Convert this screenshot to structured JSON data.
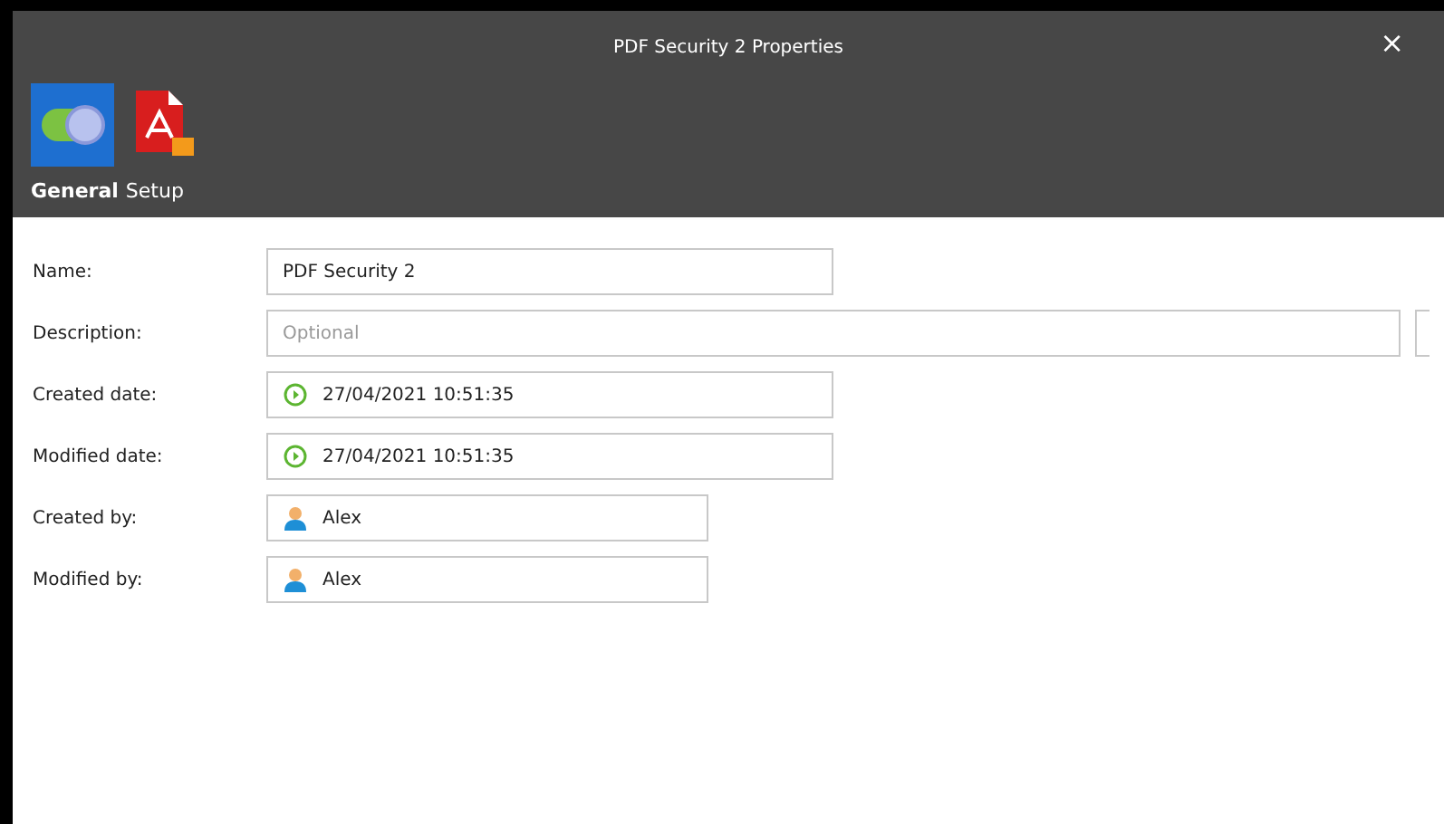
{
  "window": {
    "title": "PDF Security 2 Properties",
    "close": "×"
  },
  "tabs": [
    {
      "label": "General",
      "selected": true,
      "kind": "general"
    },
    {
      "label": "Setup",
      "selected": false,
      "kind": "pdf"
    }
  ],
  "fields": [
    {
      "label": "Name:",
      "kind": "text",
      "value": "PDF Security 2"
    },
    {
      "label": "Description:",
      "kind": "wide",
      "placeholder": "Optional"
    },
    {
      "label": "Created date:",
      "kind": "date",
      "value": "27/04/2021 10:51:35"
    },
    {
      "label": "Modified date:",
      "kind": "date",
      "value": "27/04/2021 10:51:35"
    },
    {
      "label": "Created by:",
      "kind": "user",
      "value": "Alex"
    },
    {
      "label": "Modified by:",
      "kind": "user",
      "value": "Alex"
    }
  ]
}
